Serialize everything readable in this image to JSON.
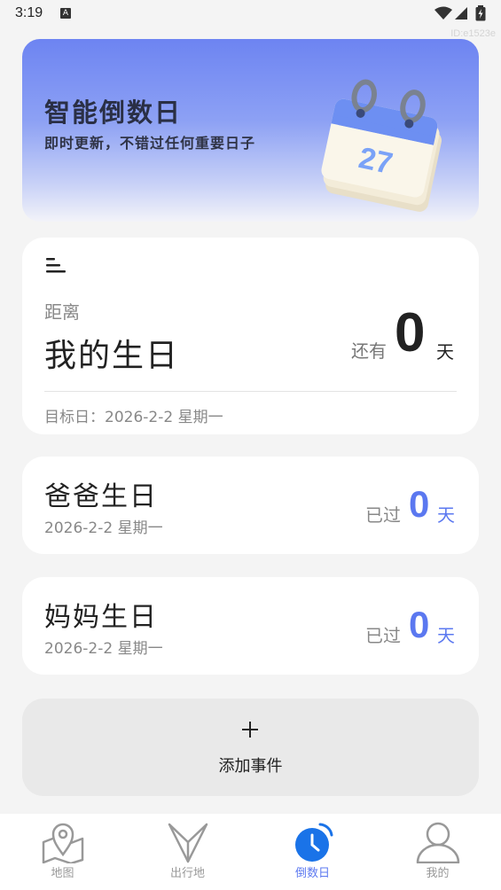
{
  "status_bar": {
    "time": "3:19",
    "id_tag": "ID:e1523e"
  },
  "banner": {
    "title": "智能倒数日",
    "subtitle": "即时更新，不错过任何重要日子",
    "calendar_number": "27"
  },
  "main_card": {
    "label": "距离",
    "title": "我的生日",
    "remain_label": "还有",
    "remain_value": "0",
    "remain_unit": "天",
    "target_date": "目标日：2026-2-2 星期一"
  },
  "events": [
    {
      "title": "爸爸生日",
      "date": "2026-2-2 星期一",
      "status_label": "已过",
      "value": "0",
      "unit": "天"
    },
    {
      "title": "妈妈生日",
      "date": "2026-2-2 星期一",
      "status_label": "已过",
      "value": "0",
      "unit": "天"
    }
  ],
  "add_button": {
    "label": "添加事件"
  },
  "tabs": [
    {
      "label": "地图",
      "icon": "map-pin-icon",
      "active": false
    },
    {
      "label": "出行地",
      "icon": "compass-icon",
      "active": false
    },
    {
      "label": "倒数日",
      "icon": "alarm-clock-icon",
      "active": true
    },
    {
      "label": "我的",
      "icon": "user-icon",
      "active": false
    }
  ],
  "colors": {
    "accent": "#5b78f0",
    "banner_top": "#6d84f2",
    "background": "#f4f4f4"
  }
}
